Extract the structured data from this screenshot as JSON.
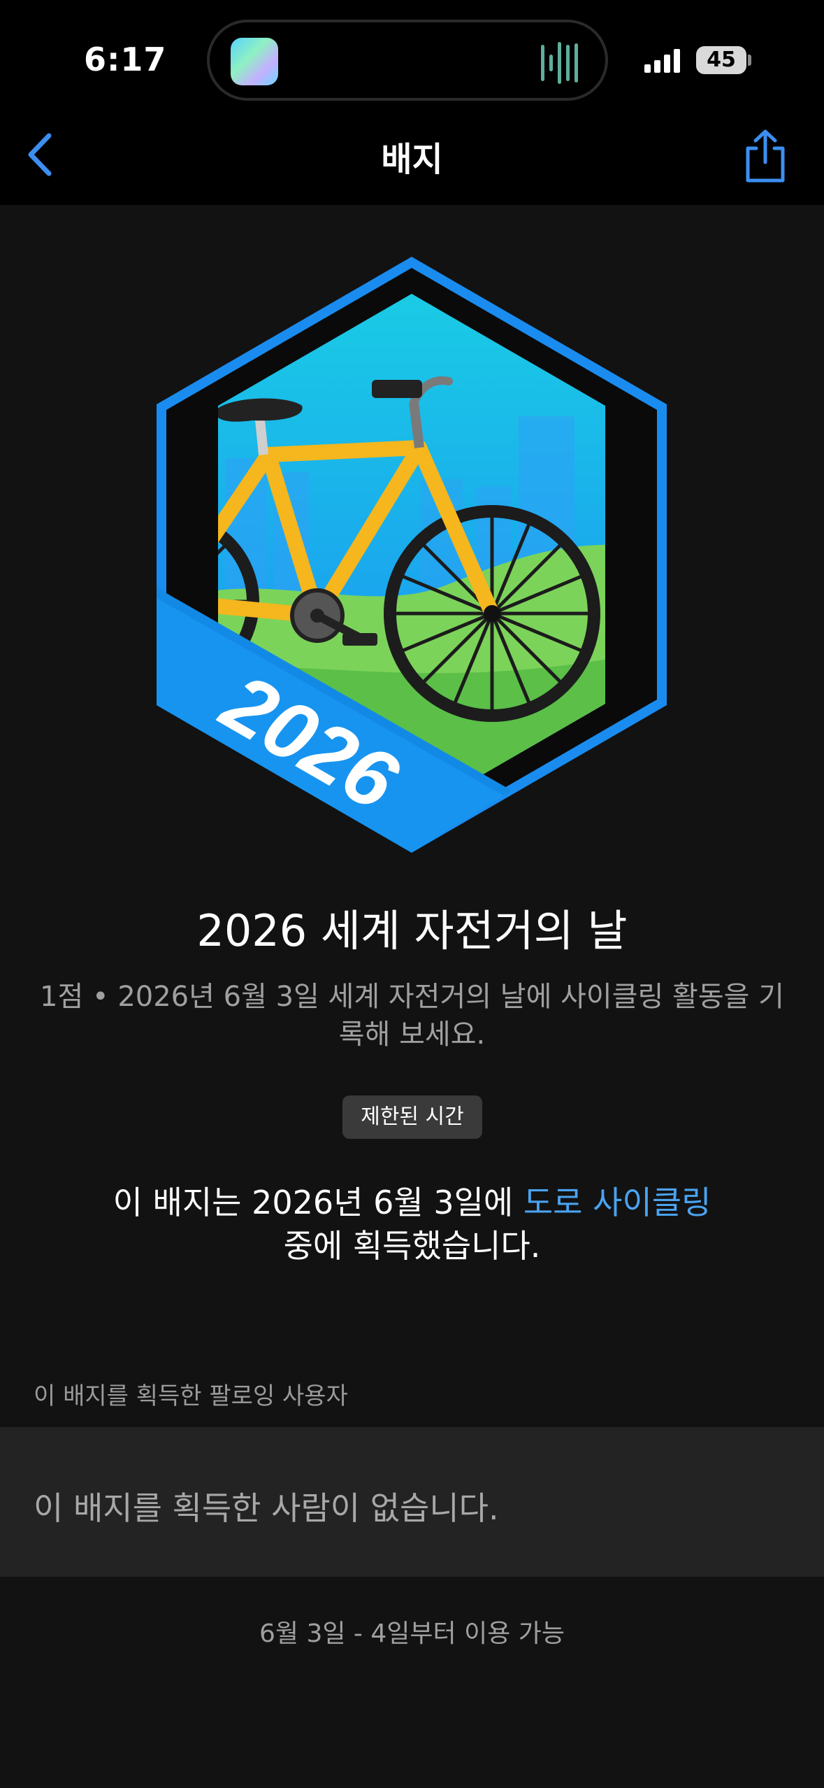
{
  "status_bar": {
    "time": "6:17",
    "battery": "45",
    "island_app_icon": "app-icon",
    "island_activity_icon": "waveform-icon",
    "signal_icon": "cellular-signal-icon"
  },
  "nav": {
    "title": "배지",
    "back_icon": "chevron-left-icon",
    "share_icon": "share-icon",
    "accent_color": "#3d8ef0"
  },
  "badge": {
    "year_text": "2026",
    "colors": {
      "outer_ring": "#1a8cf0",
      "frame": "#0a0a0a",
      "sky_top": "#1ad0e4",
      "sky_bottom": "#1a86f5",
      "hill": "#7cd35a",
      "frame_bike": "#f5b61e",
      "ribbon": "#1794f0"
    }
  },
  "title": "2026 세계 자전거의 날",
  "description": "1점 • 2026년 6월 3일 세계 자전거의 날에 사이클링 활동을 기록해 보세요.",
  "limited_tag": "제한된 시간",
  "earned": {
    "prefix": "이 배지는 2026년 6월 3일에 ",
    "activity_link": "도로 사이클링",
    "suffix": "중에 획득했습니다."
  },
  "following_section": {
    "header": "이 배지를 획득한 팔로잉 사용자",
    "empty_text": "이 배지를 획득한 사람이 없습니다."
  },
  "availability": "6월 3일 - 4일부터 이용 가능"
}
